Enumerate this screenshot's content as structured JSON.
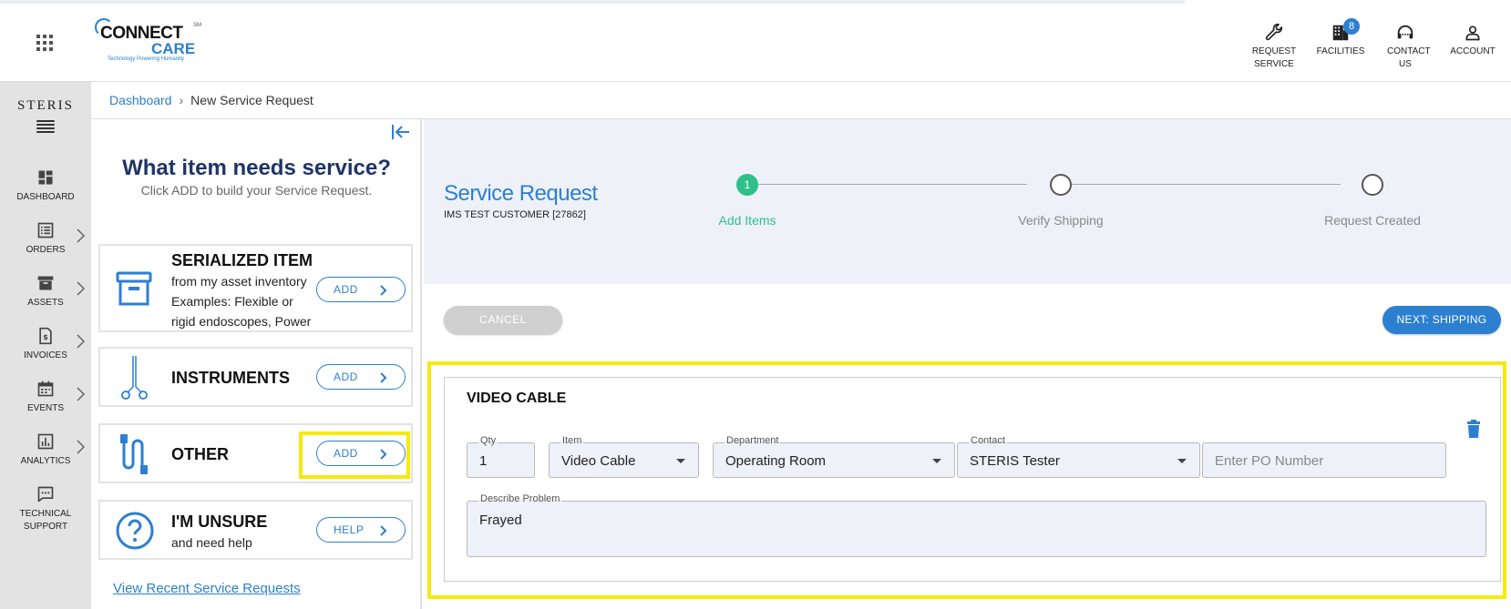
{
  "header": {
    "logo": {
      "line1": "ONNECT",
      "line2": "CARE",
      "sm": "SM",
      "tagline": "Technology Powering Humanity"
    },
    "nav": [
      {
        "label": "REQUEST SERVICE",
        "icon": "wrench-icon"
      },
      {
        "label": "FACILITIES",
        "icon": "building-icon",
        "badge": "8"
      },
      {
        "label": "CONTACT US",
        "icon": "headset-icon"
      },
      {
        "label": "ACCOUNT",
        "icon": "person-icon"
      }
    ]
  },
  "sidebar": {
    "brand": "STERIS",
    "items": [
      {
        "label": "DASHBOARD",
        "icon": "dashboard-icon",
        "has_chevron": false
      },
      {
        "label": "ORDERS",
        "icon": "orders-icon",
        "has_chevron": true
      },
      {
        "label": "ASSETS",
        "icon": "archive-icon",
        "has_chevron": true
      },
      {
        "label": "INVOICES",
        "icon": "invoice-icon",
        "has_chevron": true
      },
      {
        "label": "EVENTS",
        "icon": "calendar-icon",
        "has_chevron": true
      },
      {
        "label": "ANALYTICS",
        "icon": "analytics-icon",
        "has_chevron": true
      },
      {
        "label": "TECHNICAL SUPPORT",
        "icon": "chat-icon",
        "has_chevron": false
      }
    ]
  },
  "breadcrumb": {
    "link": "Dashboard",
    "current": "New Service Request"
  },
  "left_panel": {
    "title": "What item needs service?",
    "subtitle": "Click ADD to build your Service Request.",
    "cards": [
      {
        "title": "SERIALIZED ITEM",
        "desc": "from my asset inventory Examples: Flexible or rigid endoscopes, Power",
        "button": "ADD",
        "icon": "archive-box-icon"
      },
      {
        "title": "INSTRUMENTS",
        "desc": "",
        "button": "ADD",
        "icon": "forceps-icon"
      },
      {
        "title": "OTHER",
        "desc": "",
        "button": "ADD",
        "icon": "cable-icon"
      },
      {
        "title": "I'M UNSURE",
        "desc": "and need help",
        "button": "HELP",
        "icon": "question-circle-icon"
      }
    ],
    "recent_link": "View Recent Service Requests"
  },
  "service_request": {
    "title": "Service Request",
    "customer": "IMS TEST CUSTOMER [27862]",
    "steps": [
      {
        "number": "1",
        "label": "Add Items",
        "active": true
      },
      {
        "number": "",
        "label": "Verify Shipping",
        "active": false
      },
      {
        "number": "",
        "label": "Request Created",
        "active": false
      }
    ]
  },
  "actions": {
    "cancel": "CANCEL",
    "next": "NEXT: SHIPPING"
  },
  "item": {
    "title": "VIDEO CABLE",
    "qty_label": "Qty",
    "qty": "1",
    "item_label": "Item",
    "item_value": "Video Cable",
    "dept_label": "Department",
    "dept_value": "Operating Room",
    "contact_label": "Contact",
    "contact_value": "STERIS Tester",
    "po_placeholder": "Enter PO Number",
    "problem_label": "Describe Problem",
    "problem_value": "Frayed"
  },
  "colors": {
    "brand_blue": "#2d7fd0",
    "step_active": "#2ec08a",
    "highlight": "#f5ea0a",
    "navy": "#1d3566"
  }
}
